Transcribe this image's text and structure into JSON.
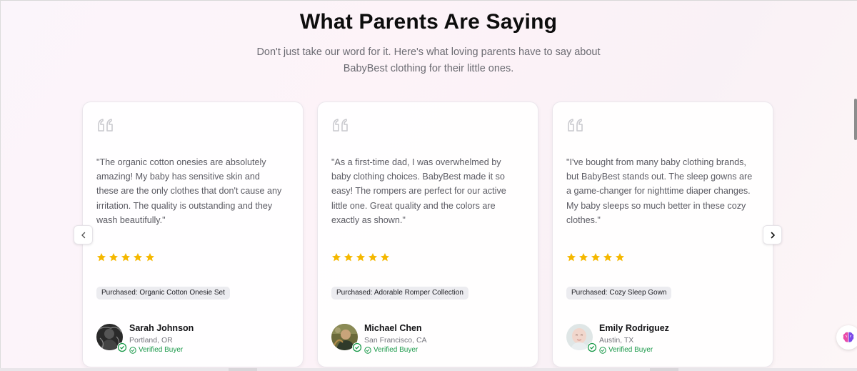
{
  "section": {
    "title": "What Parents Are Saying",
    "subtitle_line1": "Don't just take our word for it. Here's what loving parents have to say about",
    "subtitle_line2": "BabyBest clothing for their little ones."
  },
  "testimonials": [
    {
      "quote": "\"The organic cotton onesies are absolutely amazing! My baby has sensitive skin and these are the only clothes that don't cause any irritation. The quality is outstanding and they wash beautifully.\"",
      "rating": 5,
      "product": "Purchased: Organic Cotton Onesie Set",
      "name": "Sarah Johnson",
      "location": "Portland, OR",
      "verified": "Verified Buyer"
    },
    {
      "quote": "\"As a first-time dad, I was overwhelmed by baby clothing choices. BabyBest made it so easy! The rompers are perfect for our active little one. Great quality and the colors are exactly as shown.\"",
      "rating": 5,
      "product": "Purchased: Adorable Romper Collection",
      "name": "Michael Chen",
      "location": "San Francisco, CA",
      "verified": "Verified Buyer"
    },
    {
      "quote": "\"I've bought from many baby clothing brands, but BabyBest stands out. The sleep gowns are a game-changer for nighttime diaper changes. My baby sleeps so much better in these cozy clothes.\"",
      "rating": 5,
      "product": "Purchased: Cozy Sleep Gown",
      "name": "Emily Rodriguez",
      "location": "Austin, TX",
      "verified": "Verified Buyer"
    }
  ],
  "colors": {
    "star": "#f5b800",
    "verified": "#1c9a4b",
    "quote_icon": "#c9c9ce"
  },
  "icons": {
    "prev": "chevron-left-icon",
    "next": "chevron-right-icon",
    "quote": "quote-icon",
    "star": "star-icon",
    "check": "check-circle-icon",
    "assistant": "brain-icon"
  }
}
